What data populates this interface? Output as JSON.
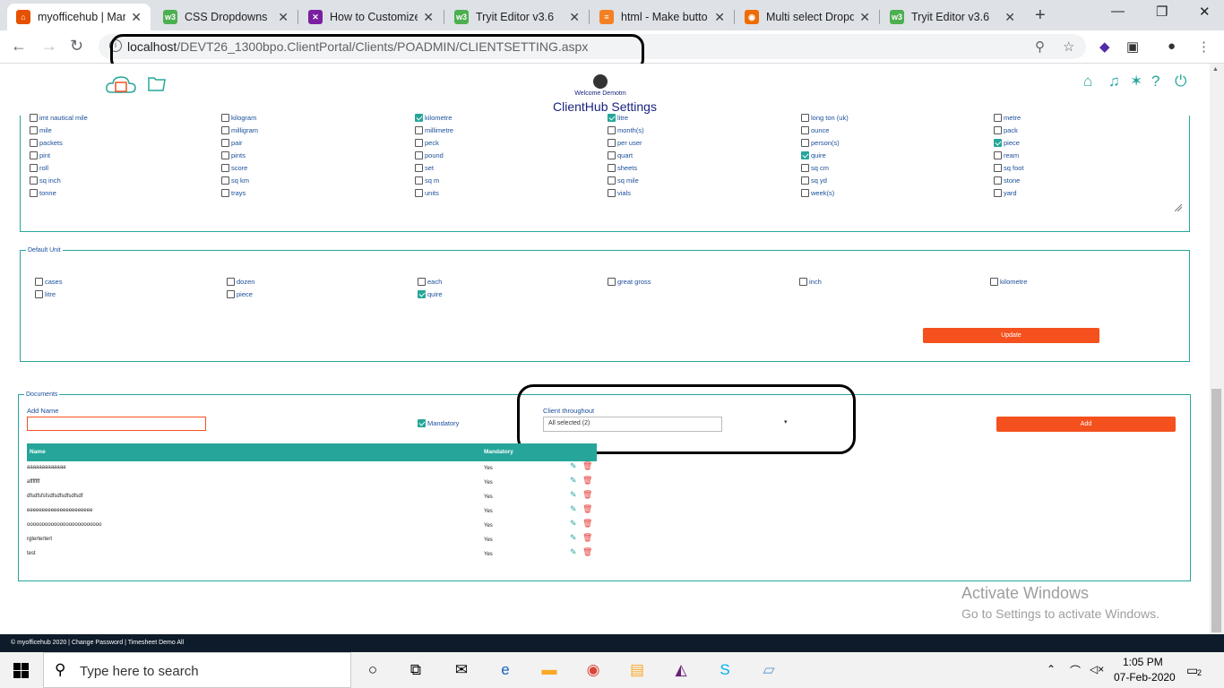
{
  "browser": {
    "tabs": [
      {
        "title": "myofficehub | Mar",
        "color": "#e65100",
        "glyph": "⌂",
        "active": true
      },
      {
        "title": "CSS Dropdowns",
        "color": "#4caf50",
        "glyph": "w3"
      },
      {
        "title": "How to Customize",
        "color": "#7b1fa2",
        "glyph": "✕"
      },
      {
        "title": "Tryit Editor v3.6",
        "color": "#4caf50",
        "glyph": "w3"
      },
      {
        "title": "html - Make butto",
        "color": "#f48024",
        "glyph": "≡"
      },
      {
        "title": "Multi select Dropd",
        "color": "#ef6c00",
        "glyph": "◉"
      },
      {
        "title": "Tryit Editor v3.6",
        "color": "#4caf50",
        "glyph": "w3"
      }
    ],
    "url_host": "localhost",
    "url_path": "/DEVT26_1300bpo.ClientPortal/Clients/POADMIN/CLIENTSETTING.aspx"
  },
  "header": {
    "welcome": "Welcome Demotm",
    "title": "ClientHub Settings"
  },
  "units": {
    "columns": [
      [
        {
          "t": "imt nautical mile",
          "c": false
        },
        {
          "t": "mile",
          "c": false
        },
        {
          "t": "packets",
          "c": false
        },
        {
          "t": "pint",
          "c": false
        },
        {
          "t": "roll",
          "c": false
        },
        {
          "t": "sq inch",
          "c": false
        },
        {
          "t": "tonne",
          "c": false
        }
      ],
      [
        {
          "t": "kilogram",
          "c": false
        },
        {
          "t": "milligram",
          "c": false
        },
        {
          "t": "pair",
          "c": false
        },
        {
          "t": "pints",
          "c": false
        },
        {
          "t": "score",
          "c": false
        },
        {
          "t": "sq km",
          "c": false
        },
        {
          "t": "trays",
          "c": false
        }
      ],
      [
        {
          "t": "kilometre",
          "c": true
        },
        {
          "t": "millimetre",
          "c": false
        },
        {
          "t": "peck",
          "c": false
        },
        {
          "t": "pound",
          "c": false
        },
        {
          "t": "set",
          "c": false
        },
        {
          "t": "sq m",
          "c": false
        },
        {
          "t": "units",
          "c": false
        }
      ],
      [
        {
          "t": "litre",
          "c": true
        },
        {
          "t": "month(s)",
          "c": false
        },
        {
          "t": "per user",
          "c": false
        },
        {
          "t": "quart",
          "c": false
        },
        {
          "t": "sheets",
          "c": false
        },
        {
          "t": "sq mile",
          "c": false
        },
        {
          "t": "vials",
          "c": false
        }
      ],
      [
        {
          "t": "long ton (uk)",
          "c": false
        },
        {
          "t": "ounce",
          "c": false
        },
        {
          "t": "person(s)",
          "c": false
        },
        {
          "t": "quire",
          "c": true
        },
        {
          "t": "sq cm",
          "c": false
        },
        {
          "t": "sq yd",
          "c": false
        },
        {
          "t": "week(s)",
          "c": false
        }
      ],
      [
        {
          "t": "metre",
          "c": false
        },
        {
          "t": "pack",
          "c": false
        },
        {
          "t": "piece",
          "c": true
        },
        {
          "t": "ream",
          "c": false
        },
        {
          "t": "sq foot",
          "c": false
        },
        {
          "t": "stone",
          "c": false
        },
        {
          "t": "yard",
          "c": false
        }
      ]
    ]
  },
  "default_unit": {
    "legend": "Default Unit",
    "row1": [
      {
        "t": "cases",
        "c": false
      },
      {
        "t": "dozen",
        "c": false
      },
      {
        "t": "each",
        "c": false
      },
      {
        "t": "great gross",
        "c": false
      },
      {
        "t": "inch",
        "c": false
      },
      {
        "t": "kilometre",
        "c": false
      }
    ],
    "row2": [
      {
        "t": "litre",
        "c": false
      },
      {
        "t": "piece",
        "c": false
      },
      {
        "t": "quire",
        "c": true
      }
    ],
    "update_label": "Update"
  },
  "documents": {
    "legend": "Documents",
    "add_name_label": "Add Name",
    "mandatory_label": "Mandatory",
    "client_throughout_label": "Client throughout",
    "client_throughout_value": "All selected (2)",
    "add_label": "Add",
    "col_name": "Name",
    "col_mandatory": "Mandatory",
    "rows": [
      {
        "name": "aaaaaaaaaaaaa",
        "mandatory": "Yes"
      },
      {
        "name": "afffffff",
        "mandatory": "Yes"
      },
      {
        "name": "dfsdfsfsfsdfsdfsdfsdfsdf",
        "mandatory": "Yes"
      },
      {
        "name": "eeeeeeeeeeeeeeeeeeeeee",
        "mandatory": "Yes"
      },
      {
        "name": "ooooooooooooooooooooooooo",
        "mandatory": "Yes"
      },
      {
        "name": "rgtertertert",
        "mandatory": "Yes"
      },
      {
        "name": "test",
        "mandatory": "Yes"
      }
    ]
  },
  "watermark": {
    "line1": "Activate Windows",
    "line2": "Go to Settings to activate Windows."
  },
  "footer": "© myofficehub 2020 | Change Password | Timesheet Demo All",
  "taskbar": {
    "search_placeholder": "Type here to search",
    "time": "1:05 PM",
    "date": "07-Feb-2020",
    "notif_count": "2"
  }
}
